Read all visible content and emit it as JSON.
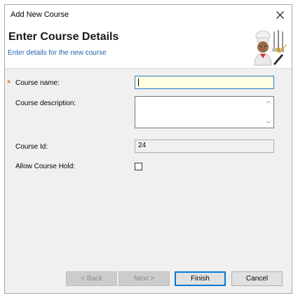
{
  "window": {
    "title": "Add New Course"
  },
  "header": {
    "title": "Enter Course Details",
    "subtitle": "Enter details for the new course",
    "icon": "chef-utensils-icon"
  },
  "form": {
    "required_marker": "*",
    "course_name": {
      "label": "Course name:",
      "value": "",
      "required": true
    },
    "course_description": {
      "label": "Course description:",
      "value": ""
    },
    "course_id": {
      "label": "Course Id:",
      "value": "24"
    },
    "allow_course_hold": {
      "label": "Allow Course Hold:",
      "checked": false
    }
  },
  "buttons": {
    "back": "< Back",
    "next": "Next >",
    "finish": "Finish",
    "cancel": "Cancel"
  },
  "colors": {
    "subtitle": "#1e63a8",
    "required": "#e38a1d",
    "focus_bg": "#ffffe1",
    "focus_border": "#2a7ccf"
  }
}
